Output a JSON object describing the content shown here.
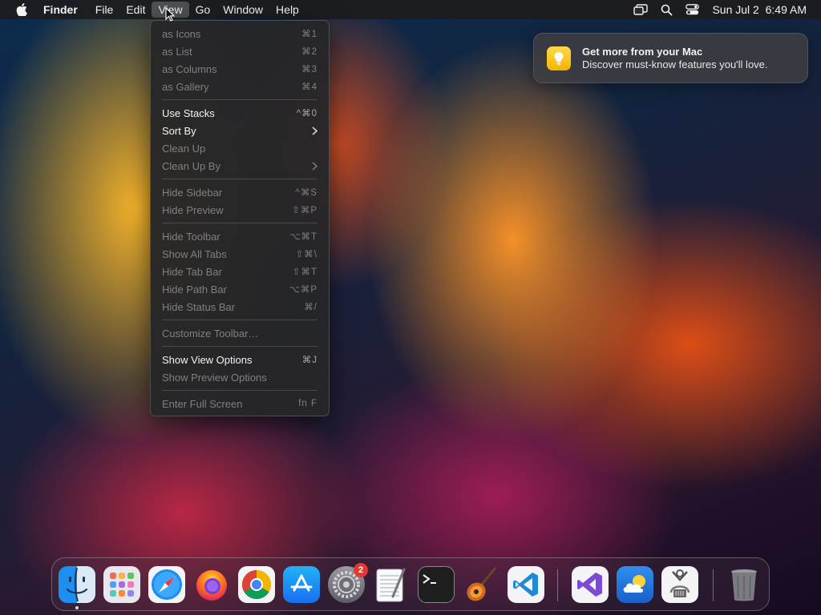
{
  "menubar": {
    "app_name": "Finder",
    "items": [
      "File",
      "Edit",
      "View",
      "Go",
      "Window",
      "Help"
    ],
    "active_item": "View",
    "clock": "Sun Jul 2  6:49 AM"
  },
  "view_menu": {
    "items": [
      {
        "label": "as Icons",
        "shortcut": "⌘1",
        "enabled": false
      },
      {
        "label": "as List",
        "shortcut": "⌘2",
        "enabled": false
      },
      {
        "label": "as Columns",
        "shortcut": "⌘3",
        "enabled": false
      },
      {
        "label": "as Gallery",
        "shortcut": "⌘4",
        "enabled": false
      },
      {
        "label": "Use Stacks",
        "shortcut": "^⌘0",
        "enabled": true
      },
      {
        "label": "Sort By",
        "shortcut": "",
        "submenu": true,
        "enabled": true
      },
      {
        "label": "Clean Up",
        "shortcut": "",
        "enabled": false
      },
      {
        "label": "Clean Up By",
        "shortcut": "",
        "submenu": true,
        "enabled": false
      },
      {
        "label": "Hide Sidebar",
        "shortcut": "^⌘S",
        "enabled": false
      },
      {
        "label": "Hide Preview",
        "shortcut": "⇧⌘P",
        "enabled": false
      },
      {
        "label": "Hide Toolbar",
        "shortcut": "⌥⌘T",
        "enabled": false
      },
      {
        "label": "Show All Tabs",
        "shortcut": "⇧⌘\\",
        "enabled": false
      },
      {
        "label": "Hide Tab Bar",
        "shortcut": "⇧⌘T",
        "enabled": false
      },
      {
        "label": "Hide Path Bar",
        "shortcut": "⌥⌘P",
        "enabled": false
      },
      {
        "label": "Hide Status Bar",
        "shortcut": "⌘/",
        "enabled": false
      },
      {
        "label": "Customize Toolbar…",
        "shortcut": "",
        "enabled": false
      },
      {
        "label": "Show View Options",
        "shortcut": "⌘J",
        "enabled": true
      },
      {
        "label": "Show Preview Options",
        "shortcut": "",
        "enabled": false
      },
      {
        "label": "Enter Full Screen",
        "shortcut": "fn F",
        "enabled": false
      }
    ]
  },
  "notification": {
    "title": "Get more from your Mac",
    "body": "Discover must-know features you'll love.",
    "icon": "lightbulb-icon"
  },
  "dock": {
    "apps": [
      {
        "name": "Finder",
        "icon": "finder-icon",
        "running": true
      },
      {
        "name": "Launchpad",
        "icon": "launchpad-icon"
      },
      {
        "name": "Safari",
        "icon": "safari-icon"
      },
      {
        "name": "Firefox",
        "icon": "firefox-icon"
      },
      {
        "name": "Chrome",
        "icon": "chrome-icon"
      },
      {
        "name": "App Store",
        "icon": "app-store-icon"
      },
      {
        "name": "System Settings",
        "icon": "settings-gear-icon",
        "badge": "2"
      },
      {
        "name": "TextEdit",
        "icon": "textedit-icon"
      },
      {
        "name": "Terminal",
        "icon": "terminal-icon"
      },
      {
        "name": "GarageBand",
        "icon": "guitar-icon"
      },
      {
        "name": "Visual Studio Code",
        "icon": "vscode-icon"
      },
      {
        "name": "Visual Studio",
        "icon": "visual-studio-icon"
      },
      {
        "name": "Weather",
        "icon": "weather-icon"
      },
      {
        "name": "System Information",
        "icon": "system-information-icon"
      },
      {
        "name": "Trash",
        "icon": "trash-icon"
      }
    ]
  },
  "colors": {
    "menu_bg": "#1c1c1e",
    "badge": "#e8382e",
    "vscode_blue": "#1f8ad2"
  }
}
